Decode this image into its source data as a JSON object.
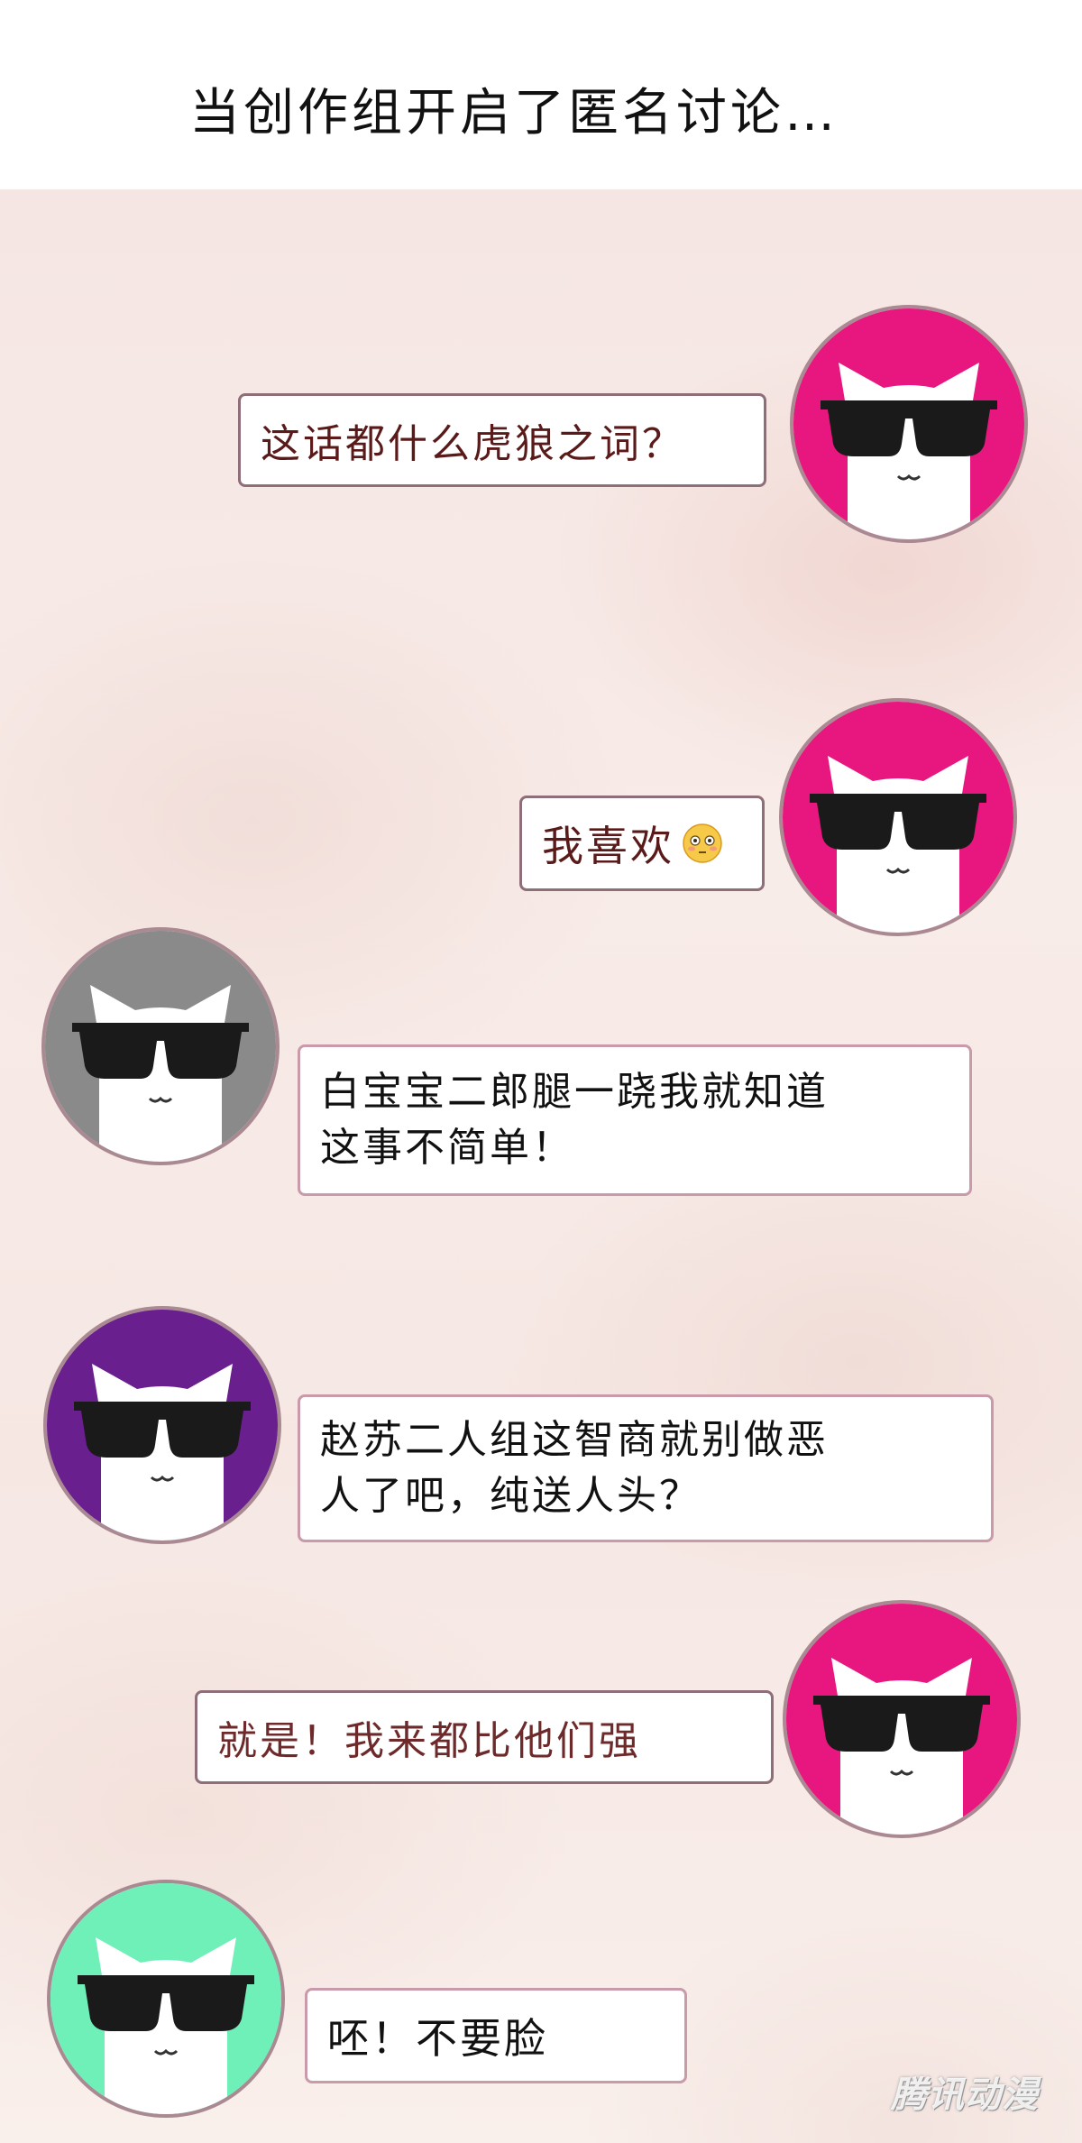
{
  "header": {
    "title": "当创作组开启了匿名讨论…"
  },
  "messages": [
    {
      "side": "right",
      "avatar_color": "#e8177f",
      "text": "这话都什么虎狼之词？",
      "text_color": "#5a1a1a"
    },
    {
      "side": "right",
      "avatar_color": "#e8177f",
      "text": "我喜欢",
      "emoji": "flushed-face-emoji",
      "text_color": "#5a1a1a"
    },
    {
      "side": "left",
      "avatar_color": "#8a8a8a",
      "text": "白宝宝二郎腿一跷我就知道\n这事不简单！",
      "text_color": "#111111"
    },
    {
      "side": "left",
      "avatar_color": "#6a1f8e",
      "text": "赵苏二人组这智商就别做恶\n人了吧，纯送人头？",
      "text_color": "#111111"
    },
    {
      "side": "right",
      "avatar_color": "#e8177f",
      "text": "就是！我来都比他们强",
      "text_color": "#6e2a2a"
    },
    {
      "side": "left",
      "avatar_color": "#6ff0b8",
      "text": "呸！不要脸",
      "text_color": "#111111"
    }
  ],
  "watermark": "腾讯动漫"
}
